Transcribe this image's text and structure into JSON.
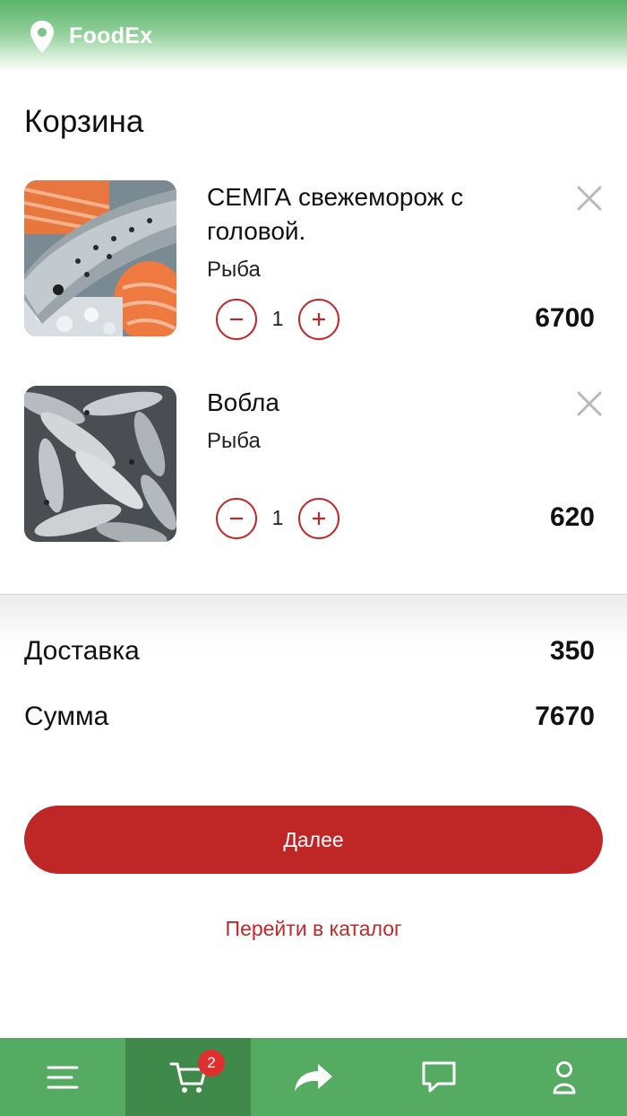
{
  "header": {
    "brand": "FoodEx",
    "location_icon": "map-pin-icon"
  },
  "page": {
    "title": "Корзина"
  },
  "cart": {
    "items": [
      {
        "name": "СЕМГА свежеморож с головой.",
        "category": "Рыба",
        "quantity": "1",
        "price": "6700",
        "image": "salmon-photo"
      },
      {
        "name": "Вобла",
        "category": "Рыба",
        "quantity": "1",
        "price": "620",
        "image": "roach-fish-photo"
      }
    ],
    "remove_icon": "close-icon",
    "minus_icon": "minus-icon",
    "plus_icon": "plus-icon"
  },
  "summary": {
    "delivery_label": "Доставка",
    "delivery_value": "350",
    "total_label": "Сумма",
    "total_value": "7670"
  },
  "actions": {
    "next_label": "Далее",
    "catalog_label": "Перейти в каталог"
  },
  "tabbar": {
    "tabs": [
      {
        "icon": "menu-icon",
        "active": false
      },
      {
        "icon": "cart-icon",
        "active": true,
        "badge": "2"
      },
      {
        "icon": "share-icon",
        "active": false
      },
      {
        "icon": "chat-icon",
        "active": false
      },
      {
        "icon": "profile-icon",
        "active": false
      }
    ]
  },
  "colors": {
    "brand_green": "#56ab63",
    "active_tab_green": "#3f8a4a",
    "accent_red": "#bf2726",
    "badge_red": "#e0302d"
  }
}
